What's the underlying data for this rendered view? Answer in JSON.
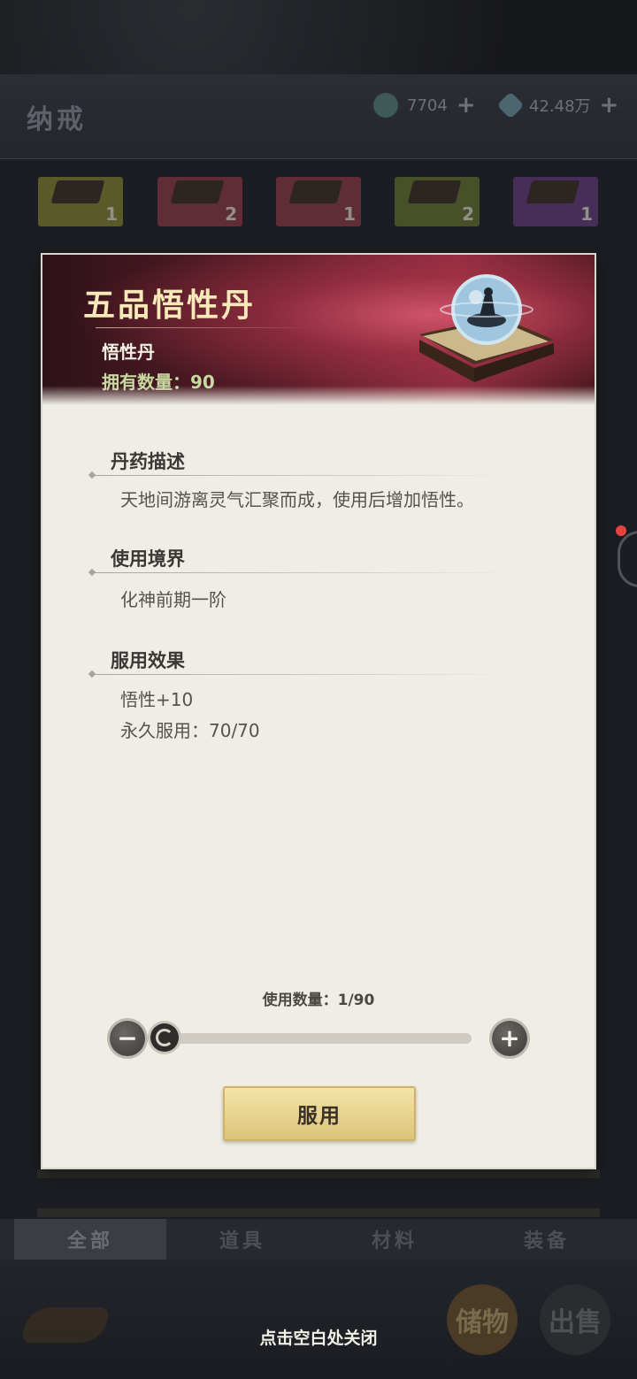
{
  "header": {
    "title": "纳戒",
    "currency1": {
      "amount": "7704",
      "icon": "jade-coin-icon"
    },
    "currency2": {
      "amount": "42.48万",
      "icon": "spirit-stone-icon"
    },
    "plus_symbol": "+"
  },
  "slots": [
    {
      "count": "1",
      "color": "#8f8a2e"
    },
    {
      "count": "2",
      "color": "#9a3a46"
    },
    {
      "count": "1",
      "color": "#9a3a46"
    },
    {
      "count": "2",
      "color": "#6e7a32"
    },
    {
      "count": "1",
      "color": "#6a3c86"
    }
  ],
  "item": {
    "name": "五品悟性丹",
    "type": "悟性丹",
    "owned": "拥有数量：90",
    "sections": [
      {
        "title": "丹药描述",
        "lines": [
          "天地间游离灵气汇聚而成，使用后增加悟性。"
        ]
      },
      {
        "title": "使用境界",
        "lines": [
          "化神前期一阶"
        ]
      },
      {
        "title": "服用效果",
        "lines": [
          "悟性+10",
          "永久服用：70/70"
        ]
      }
    ]
  },
  "quantity": {
    "label": "使用数量：1/90",
    "current": 1,
    "max": 90,
    "minus": "−",
    "plus": "+"
  },
  "use_button": "服用",
  "tabs": [
    "全部",
    "道具",
    "材料",
    "装备"
  ],
  "active_tab": 0,
  "bottom": {
    "store_label": "储物",
    "sell_label": "出售",
    "close_hint": "点击空白处关闭"
  }
}
